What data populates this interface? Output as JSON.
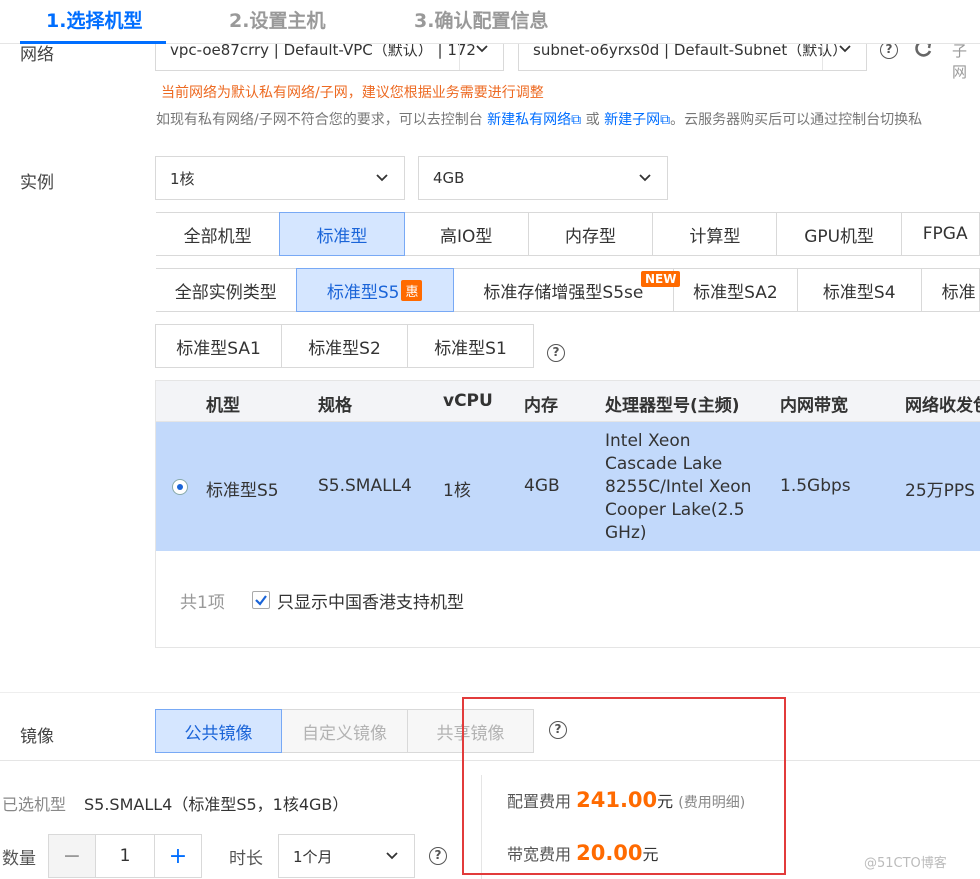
{
  "steps": [
    {
      "label": "1.选择机型"
    },
    {
      "label": "2.设置主机"
    },
    {
      "label": "3.确认配置信息"
    }
  ],
  "network": {
    "label": "网络",
    "vpc_value": "vpc-oe87crry | Default-VPC（默认） | 172",
    "subnet_value": "subnet-o6yrxs0d | Default-Subnet（默认）",
    "extra_text": "子网",
    "warning": "当前网络为默认私有网络/子网，建议您根据业务需要进行调整",
    "tip_prefix": "如现有私有网络/子网不符合您的要求，可以去控制台",
    "tip_link1": "新建私有网络",
    "tip_mid": "或",
    "tip_link2": "新建子网",
    "tip_suffix": "。云服务器购买后可以通过控制台切换私"
  },
  "instance": {
    "label": "实例",
    "cpu_value": "1核",
    "mem_value": "4GB",
    "families": [
      "全部机型",
      "标准型",
      "高IO型",
      "内存型",
      "计算型",
      "GPU机型",
      "FPGA"
    ],
    "types_row1": [
      "全部实例类型",
      "标准型S5",
      "标准存储增强型S5se",
      "标准型SA2",
      "标准型S4",
      "标准"
    ],
    "types_row2": [
      "标准型SA1",
      "标准型S2",
      "标准型S1"
    ],
    "badge_hui": "惠",
    "badge_new": "NEW"
  },
  "table": {
    "headers": [
      "机型",
      "规格",
      "vCPU",
      "内存",
      "处理器型号(主频)",
      "内网带宽",
      "网络收发包"
    ],
    "row": {
      "model": "标准型S5",
      "spec": "S5.SMALL4",
      "vcpu": "1核",
      "memory": "4GB",
      "processor_lines": [
        "Intel Xeon",
        "Cascade Lake",
        "8255C/Intel Xeon",
        "Cooper Lake(2.5",
        "GHz)"
      ],
      "bandwidth": "1.5Gbps",
      "pps": "25万PPS"
    },
    "total": "共1项",
    "checkbox_label": "只显示中国香港支持机型"
  },
  "image": {
    "label": "镜像",
    "options": [
      "公共镜像",
      "自定义镜像",
      "共享镜像"
    ]
  },
  "summary": {
    "selected_label": "已选机型",
    "selected_value": "S5.SMALL4（标准型S5，1核4GB）",
    "qty_label": "数量",
    "qty_value": "1",
    "minus": "−",
    "plus": "+",
    "duration_label": "时长",
    "duration_value": "1个月",
    "config_fee_label": "配置费用",
    "config_fee_value": "241.00",
    "yuan": "元",
    "fee_detail": "(费用明细)",
    "bandwidth_fee_label": "带宽费用",
    "bandwidth_fee_value": "20.00"
  },
  "watermark": "@51CTO博客",
  "colors": {
    "accent": "#006eff",
    "price": "#ff6a00",
    "highlight": "#e23b3b"
  }
}
